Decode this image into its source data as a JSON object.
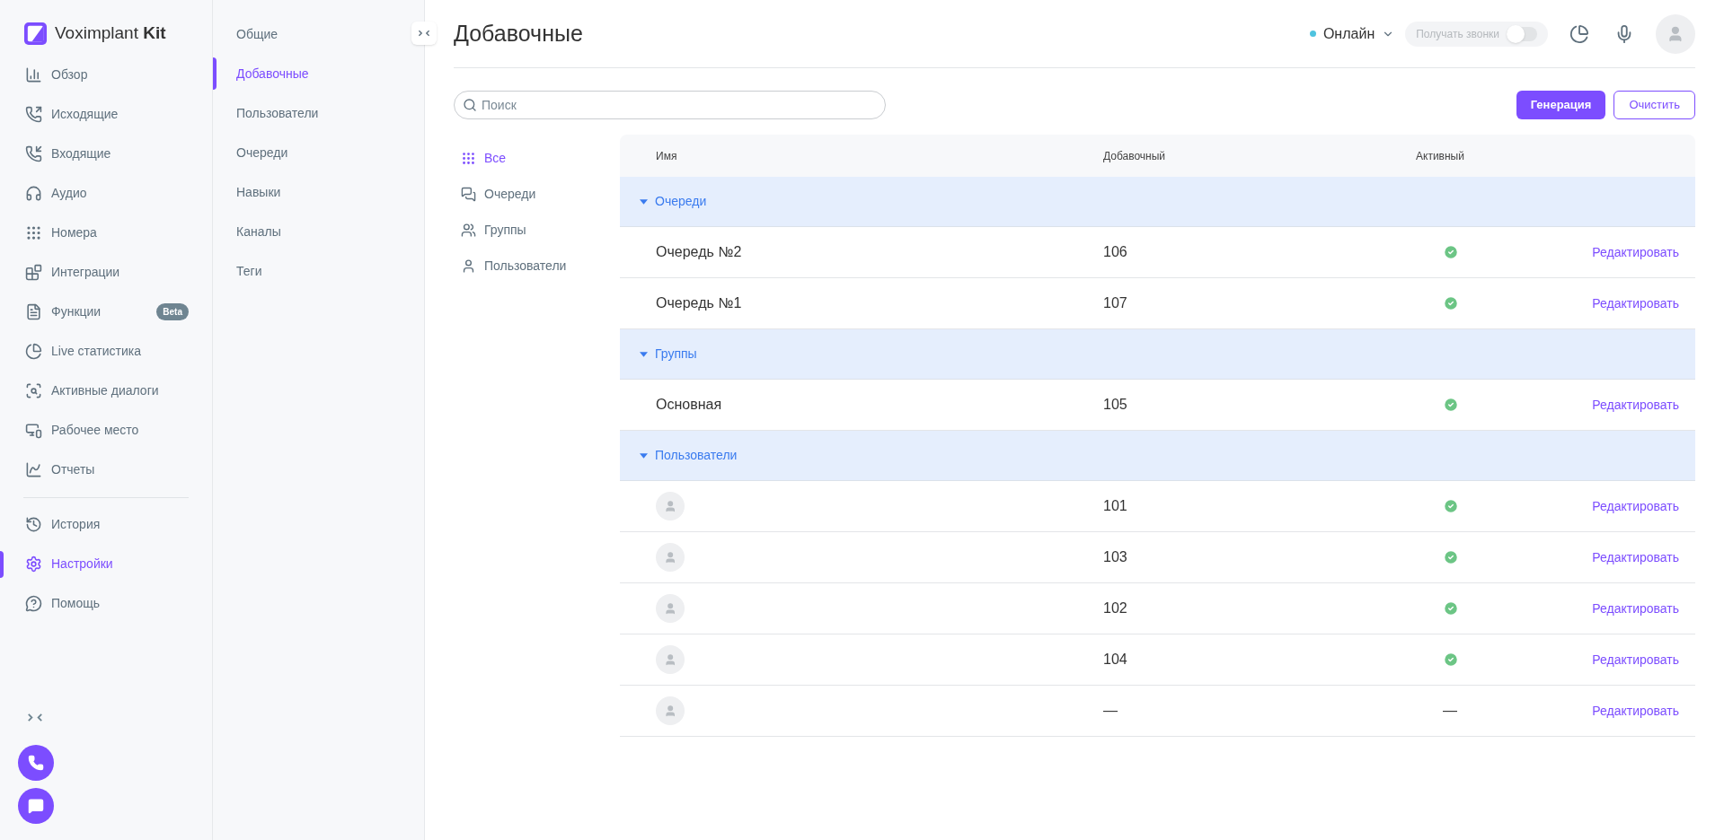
{
  "brand": {
    "name": "Voximplant",
    "suffix": "Kit"
  },
  "sidebar": {
    "items": [
      {
        "label": "Обзор",
        "kind": "overview",
        "selected": false
      },
      {
        "label": "Исходящие",
        "kind": "outgoing",
        "selected": false
      },
      {
        "label": "Входящие",
        "kind": "incoming",
        "selected": false
      },
      {
        "label": "Аудио",
        "kind": "audio",
        "selected": false
      },
      {
        "label": "Номера",
        "kind": "dialpad",
        "selected": false
      },
      {
        "label": "Интеграции",
        "kind": "integrations",
        "selected": false
      },
      {
        "label": "Функции",
        "kind": "functions",
        "selected": false,
        "badge": "Beta"
      },
      {
        "label": "Live статистика",
        "kind": "pie",
        "selected": false
      },
      {
        "label": "Активные диалоги",
        "kind": "dialogs",
        "selected": false
      },
      {
        "label": "Рабочее место",
        "kind": "workplace",
        "selected": false
      },
      {
        "label": "Отчеты",
        "kind": "reports",
        "selected": false
      }
    ],
    "bottom_items": [
      {
        "label": "История",
        "kind": "history",
        "selected": false
      },
      {
        "label": "Настройки",
        "kind": "settings",
        "selected": true
      },
      {
        "label": "Помощь",
        "kind": "help",
        "selected": false
      }
    ]
  },
  "settings_nav": [
    {
      "label": "Общие",
      "selected": false
    },
    {
      "label": "Добавочные",
      "selected": true
    },
    {
      "label": "Пользователи",
      "selected": false
    },
    {
      "label": "Очереди",
      "selected": false
    },
    {
      "label": "Навыки",
      "selected": false
    },
    {
      "label": "Каналы",
      "selected": false
    },
    {
      "label": "Теги",
      "selected": false
    }
  ],
  "header": {
    "title": "Добавочные",
    "status": "Онлайн",
    "calls_toggle": {
      "label": "Получать звонки",
      "on": false
    }
  },
  "search": {
    "placeholder": "Поиск"
  },
  "buttons": {
    "primary": "Генерация",
    "secondary": "Очистить"
  },
  "filters": [
    {
      "label": "Все",
      "kind": "dialpad",
      "selected": true
    },
    {
      "label": "Очереди",
      "kind": "queue",
      "selected": false
    },
    {
      "label": "Группы",
      "kind": "group",
      "selected": false
    },
    {
      "label": "Пользователи",
      "kind": "user",
      "selected": false
    }
  ],
  "table": {
    "columns": [
      "Имя",
      "Добавочный",
      "Активный"
    ],
    "groups": [
      {
        "label": "Очереди",
        "expanded": true,
        "rows": [
          {
            "kind": "named",
            "name": "Очередь №2",
            "extension": "106",
            "active": {
              "kind": "check"
            },
            "action": "Редактировать"
          },
          {
            "kind": "named",
            "name": "Очередь №1",
            "extension": "107",
            "active": {
              "kind": "check"
            },
            "action": "Редактировать"
          }
        ]
      },
      {
        "label": "Группы",
        "expanded": true,
        "rows": [
          {
            "kind": "named",
            "name": "Основная",
            "extension": "105",
            "active": {
              "kind": "check"
            },
            "action": "Редактировать"
          }
        ]
      },
      {
        "label": "Пользователи",
        "expanded": true,
        "rows": [
          {
            "kind": "avatar",
            "extension": "101",
            "active": {
              "kind": "check"
            },
            "action": "Редактировать"
          },
          {
            "kind": "avatar",
            "extension": "103",
            "active": {
              "kind": "check"
            },
            "action": "Редактировать"
          },
          {
            "kind": "avatar",
            "extension": "102",
            "active": {
              "kind": "check"
            },
            "action": "Редактировать"
          },
          {
            "kind": "avatar",
            "extension": "104",
            "active": {
              "kind": "check"
            },
            "action": "Редактировать"
          },
          {
            "kind": "avatar",
            "extension": "—",
            "active": {
              "kind": "text",
              "text": "—"
            },
            "action": "Редактировать"
          }
        ]
      }
    ]
  }
}
